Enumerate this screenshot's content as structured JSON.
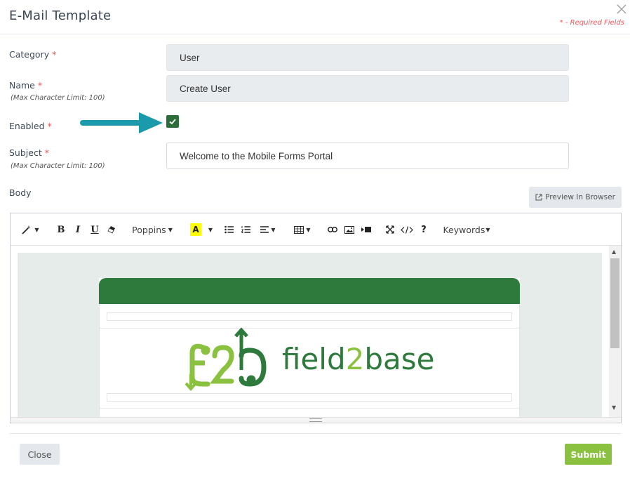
{
  "modal": {
    "title": "E-Mail Template",
    "required_note": "* - Required Fields",
    "close_icon": "close-icon"
  },
  "form": {
    "category": {
      "label": "Category",
      "required": "*",
      "value": "User"
    },
    "name": {
      "label": "Name",
      "required": "*",
      "sublabel": "(Max Character Limit: 100)",
      "value": "Create User"
    },
    "enabled": {
      "label": "Enabled",
      "required": "*",
      "checked": true
    },
    "subject": {
      "label": "Subject",
      "required": "*",
      "sublabel": "(Max Character Limit: 100)",
      "value": "Welcome to the Mobile Forms Portal"
    },
    "body": {
      "label": "Body"
    }
  },
  "preview_button": {
    "label": "Preview In Browser",
    "icon": "external-link-icon"
  },
  "toolbar": {
    "style_icon": "magic-wand-icon",
    "bold": "B",
    "italic": "I",
    "underline": "U",
    "eraser_icon": "eraser-icon",
    "font_family": "Poppins",
    "font_color": "A",
    "keywords": "Keywords",
    "help": "?"
  },
  "email_preview": {
    "logo_text_1": "field",
    "logo_text_2": "2",
    "logo_text_3": "base",
    "logo_icon": "f2b-logo-icon"
  },
  "colors": {
    "brand_dark_green": "#2e7a3d",
    "brand_light_green": "#8ac240",
    "arrow_teal": "#1a9aab",
    "required_red": "#e8565a"
  },
  "footer": {
    "close_label": "Close",
    "submit_label": "Submit"
  }
}
